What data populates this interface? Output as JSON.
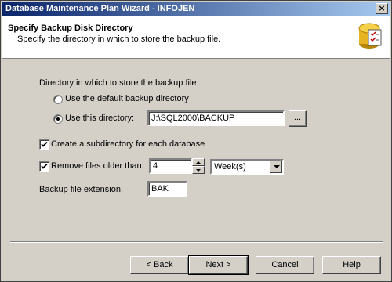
{
  "window": {
    "title": "Database Maintenance Plan Wizard - INFOJEN",
    "close_glyph": "×"
  },
  "header": {
    "title": "Specify Backup Disk Directory",
    "subtitle": "Specify the directory in which to store the backup file.",
    "logo_icon": "wizard-database-checklist-icon"
  },
  "directory": {
    "group_label": "Directory in which to store the backup file:",
    "option_default_label": "Use the default backup directory",
    "option_custom_label": "Use this directory:",
    "selected_option": "custom",
    "path_value": "J:\\SQL2000\\BACKUP",
    "browse_label": "..."
  },
  "subdirectory": {
    "label": "Create a subdirectory for each database",
    "checked": true
  },
  "remove_old": {
    "label": "Remove files older than:",
    "checked": true,
    "amount": "4",
    "unit_selected": "Week(s)"
  },
  "extension": {
    "label": "Backup file extension:",
    "value": "BAK"
  },
  "buttons": {
    "back": "< Back",
    "next": "Next >",
    "cancel": "Cancel",
    "help": "Help"
  },
  "colors": {
    "titlebar_start": "#0a246a",
    "titlebar_end": "#a6caf0",
    "dialog_face": "#d4d0c8"
  }
}
